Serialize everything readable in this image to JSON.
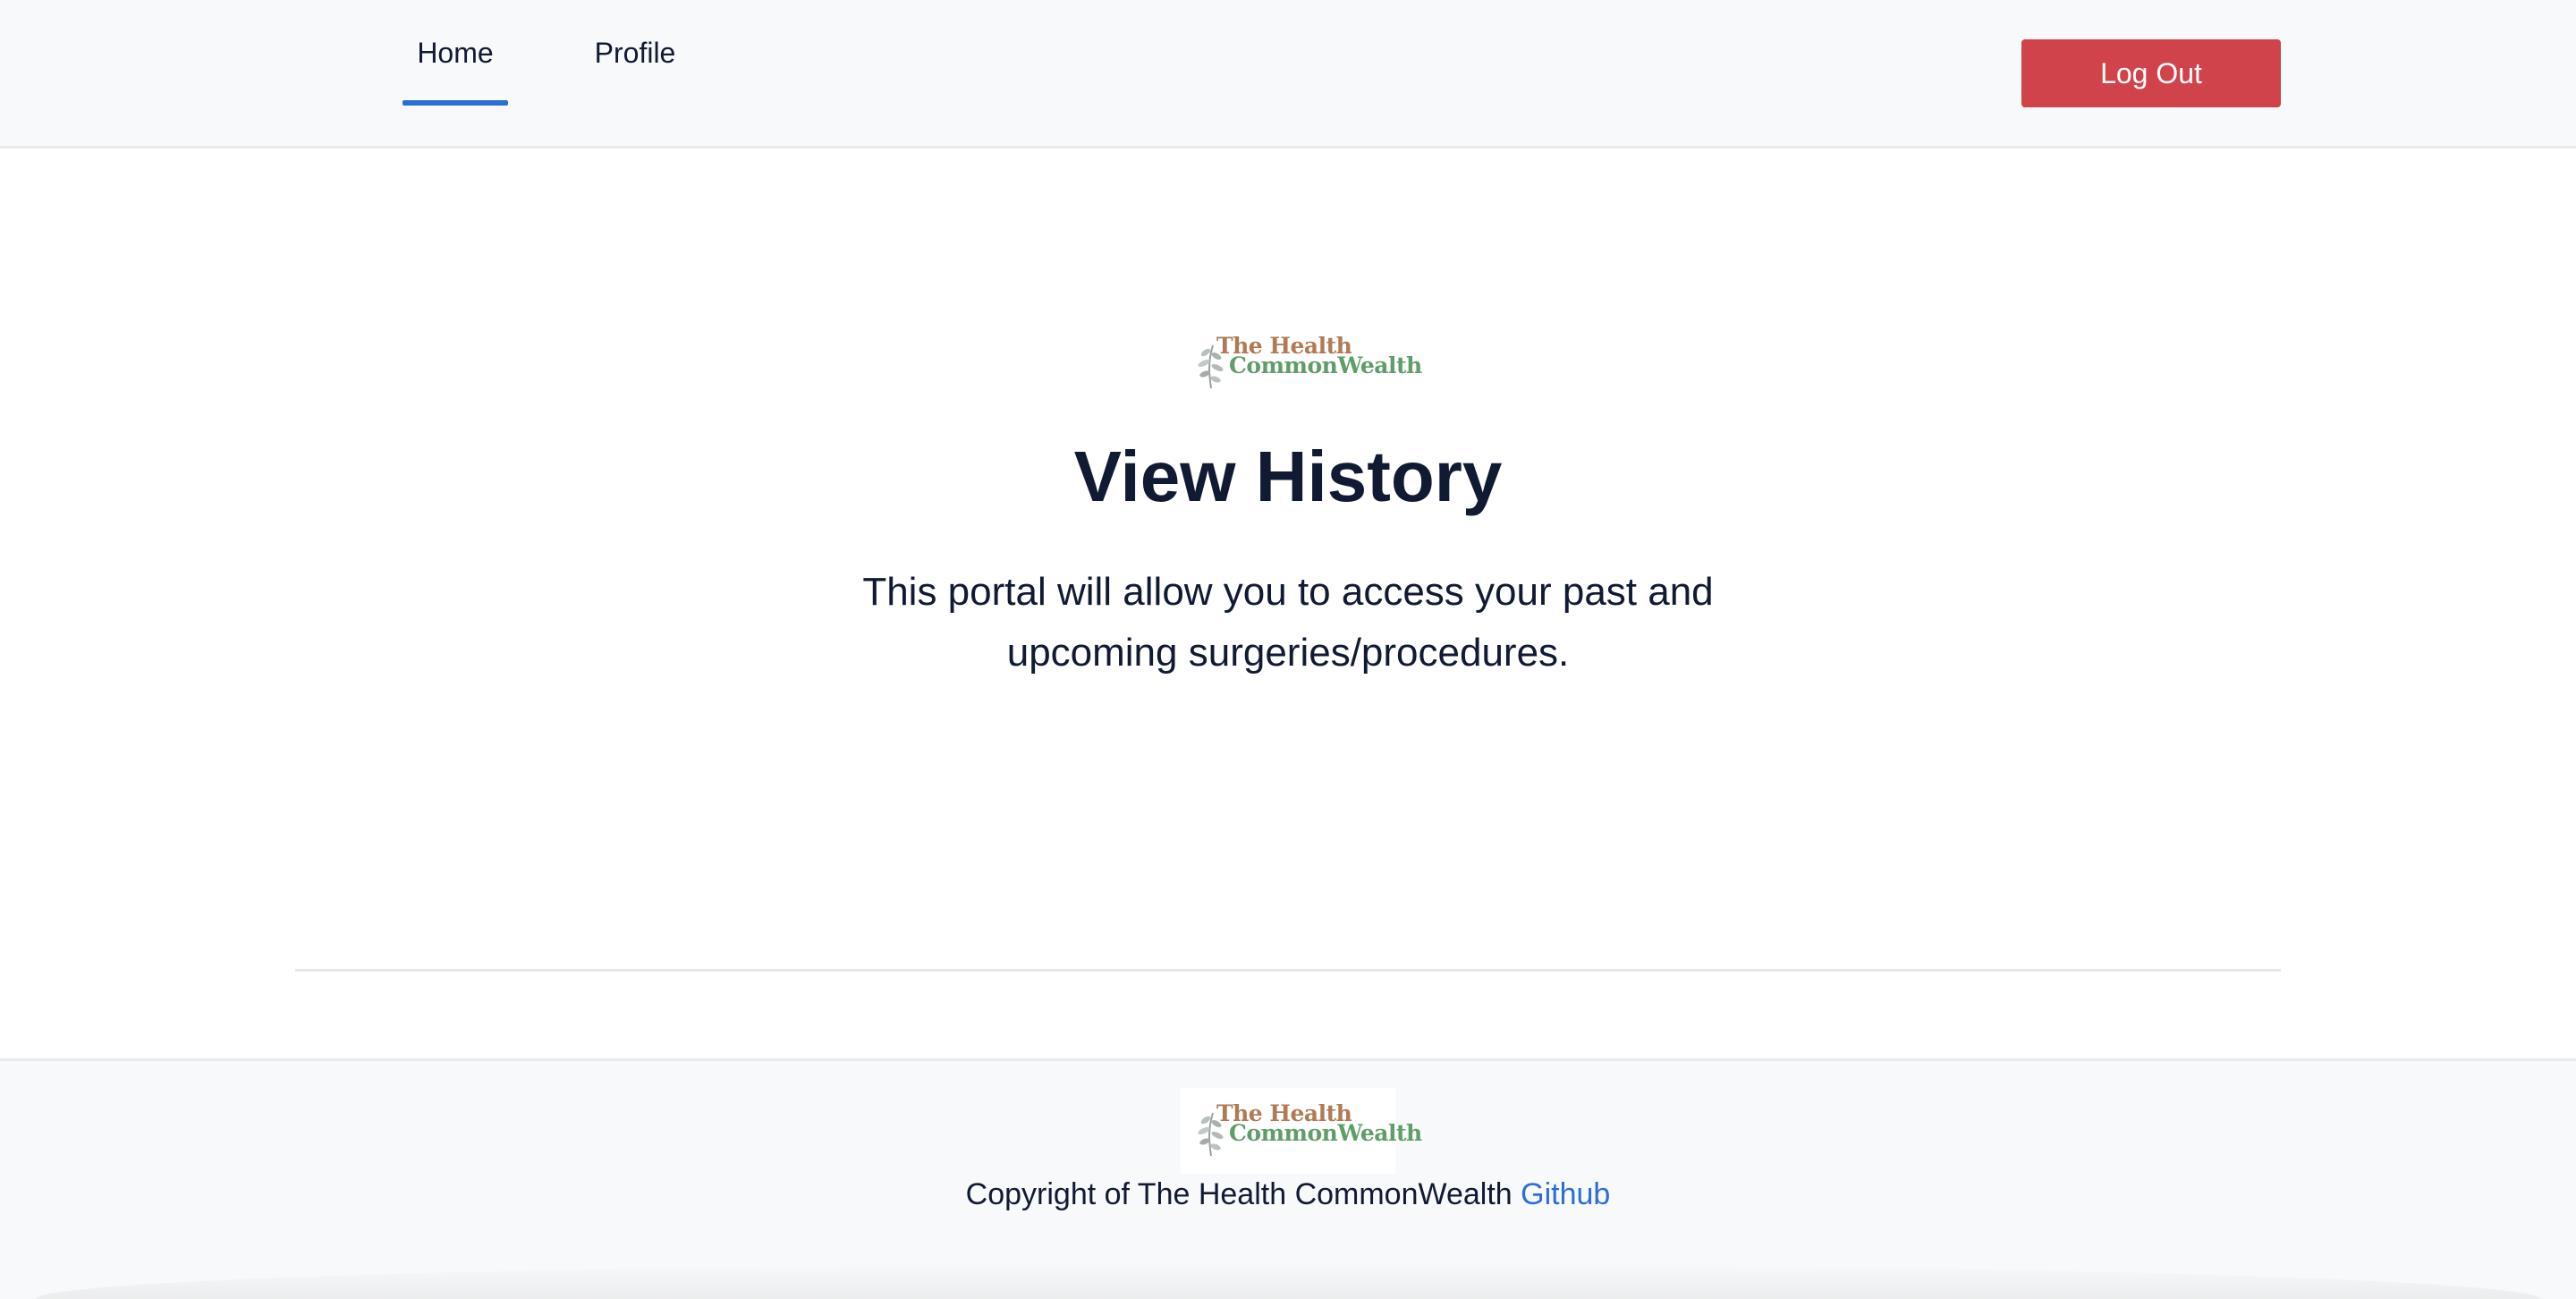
{
  "nav": {
    "tabs": [
      {
        "label": "Home",
        "active": true
      },
      {
        "label": "Profile",
        "active": false
      }
    ],
    "logout_label": "Log Out"
  },
  "logo": {
    "line1": "The Health",
    "line2": "CommonWealth"
  },
  "hero": {
    "title": "View History",
    "lead": "This portal will allow you to access your past and upcoming surgeries/procedures."
  },
  "footer": {
    "copyright_text": "Copyright of The Health CommonWealth",
    "github_label": "Github"
  },
  "colors": {
    "accent": "#2b6fd6",
    "logout": "#d0434b",
    "logo_brown": "#b07a55",
    "logo_green": "#5e9e68"
  }
}
